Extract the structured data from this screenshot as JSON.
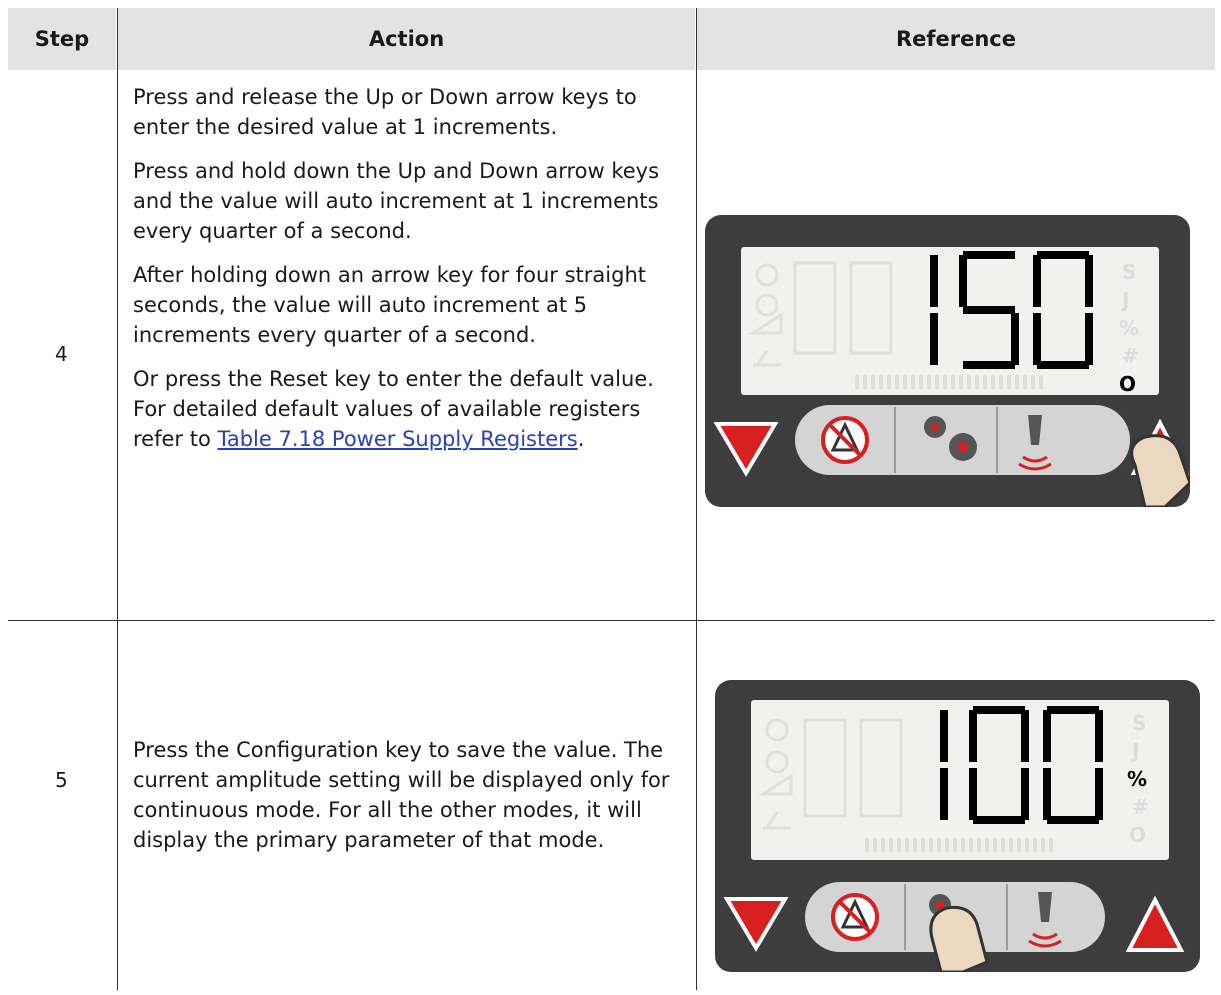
{
  "headers": {
    "step": "Step",
    "action": "Action",
    "reference": "Reference"
  },
  "row4": {
    "step": "4",
    "p1": "Press and release the Up or Down arrow keys to enter the desired value at 1 increments.",
    "p2": "Press and hold down the Up and Down arrow keys and the value will auto increment at 1 increments every quarter of a second.",
    "p3": "After holding down an arrow key for four straight seconds, the value will auto increment at 5 increments every quarter of a second.",
    "p4_before": "Or press the Reset key to enter the default value. For detailed default values of available registers refer to ",
    "p4_link": "Table 7.18 Power Supply Registers",
    "p4_after": ".",
    "display": {
      "value": "150",
      "unit_symbol": "O"
    }
  },
  "row5": {
    "step": "5",
    "p1": "Press the Configuration key to save the value. The current amplitude setting will be displayed only for continuous mode. For all the other modes, it will display the primary parameter of that mode.",
    "display": {
      "value": "100",
      "unit_symbol": "%"
    }
  },
  "colors": {
    "header_bg": "#e3e3e3",
    "link": "#2b3fb8",
    "panel_bezel": "#3d3d3d",
    "lcd": "#f1f2ef",
    "arrow_red": "#d92020"
  },
  "icons": [
    "down-arrow-icon",
    "up-arrow-icon",
    "alarm-mute-icon",
    "gear-icon",
    "horn-icon",
    "finger-press-icon"
  ]
}
